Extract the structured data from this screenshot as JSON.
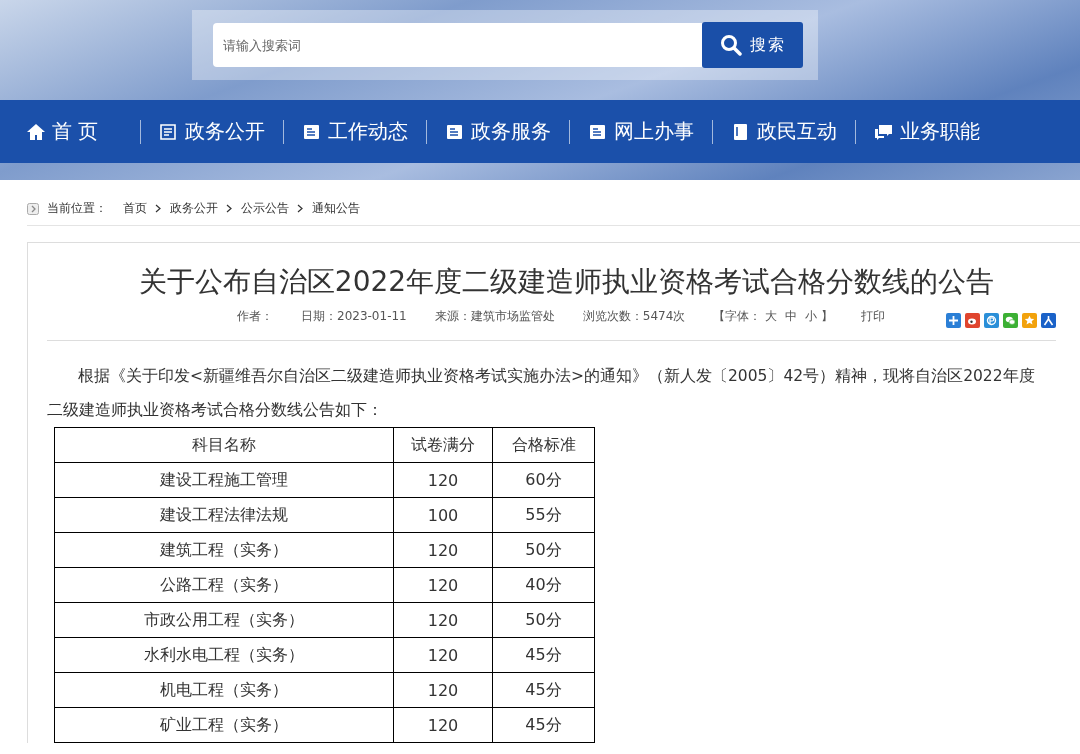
{
  "search": {
    "placeholder": "请输入搜索词",
    "button": "搜索"
  },
  "nav": [
    {
      "label": "首 页",
      "kind": "home"
    },
    {
      "label": "政务公开",
      "kind": "doc"
    },
    {
      "label": "工作动态",
      "kind": "card"
    },
    {
      "label": "政务服务",
      "kind": "card"
    },
    {
      "label": "网上办事",
      "kind": "card"
    },
    {
      "label": "政民互动",
      "kind": "book"
    },
    {
      "label": "业务职能",
      "kind": "chat"
    }
  ],
  "breadcrumb": {
    "label": "当前位置：",
    "items": [
      "首页",
      "政务公开",
      "公示公告",
      "通知公告"
    ]
  },
  "article": {
    "title": "关于公布自治区2022年度二级建造师执业资格考试合格分数线的公告",
    "meta": [
      "作者：",
      "日期：2023-01-11",
      "来源：建筑市场监管处",
      "浏览次数：5474次"
    ],
    "font_size": {
      "open": "【字体：",
      "sizes": [
        "大",
        "中",
        "小"
      ],
      "close": "】"
    },
    "print": "打印",
    "share": [
      {
        "kind": "plus",
        "color": "#2b7fd6"
      },
      {
        "kind": "weibo",
        "color": "#e0452e"
      },
      {
        "kind": "p",
        "color": "#2a8fd8"
      },
      {
        "kind": "wechat",
        "color": "#3cb034"
      },
      {
        "kind": "star",
        "color": "#f2a20c"
      },
      {
        "kind": "person",
        "color": "#1b62c8"
      }
    ],
    "paragraph": "根据《关于印发<新疆维吾尔自治区二级建造师执业资格考试实施办法>的通知》（新人发〔2005〕42号）精神，现将自治区2022年度二级建造师执业资格考试合格分数线公告如下：",
    "table": {
      "columns": [
        "科目名称",
        "试卷满分",
        "合格标准"
      ],
      "rows": [
        [
          "建设工程施工管理",
          "120",
          "60分"
        ],
        [
          "建设工程法律法规",
          "100",
          "55分"
        ],
        [
          "建筑工程（实务）",
          "120",
          "50分"
        ],
        [
          "公路工程（实务）",
          "120",
          "40分"
        ],
        [
          "市政公用工程（实务）",
          "120",
          "50分"
        ],
        [
          "水利水电工程（实务）",
          "120",
          "45分"
        ],
        [
          "机电工程（实务）",
          "120",
          "45分"
        ],
        [
          "矿业工程（实务）",
          "120",
          "45分"
        ]
      ]
    }
  }
}
